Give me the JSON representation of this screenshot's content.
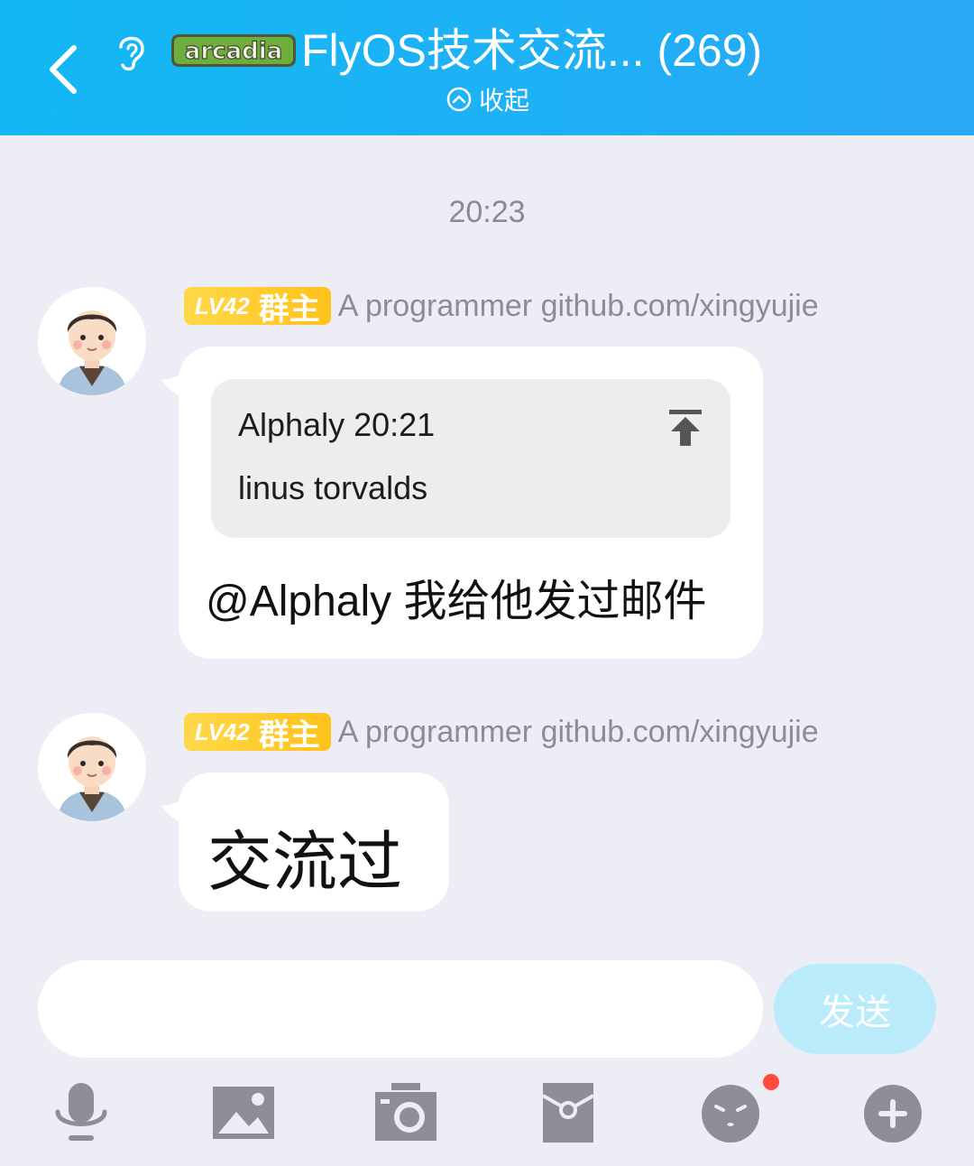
{
  "header": {
    "group_name": "FlyOS技术交流... (269)",
    "collapse_label": "收起",
    "badge_text": "arcadia"
  },
  "timestamp": "20:23",
  "messages": [
    {
      "level": "LV42",
      "role": "群主",
      "sender": "A programmer github.com/xingyujie",
      "quote": {
        "sender_time": "Alphaly 20:21",
        "text": "linus torvalds"
      },
      "text": "@Alphaly 我给他发过邮件"
    },
    {
      "level": "LV42",
      "role": "群主",
      "sender": "A programmer github.com/xingyujie",
      "text": "交流过"
    }
  ],
  "composer": {
    "input_value": "",
    "send_label": "发送"
  },
  "toolbar": {
    "icons": [
      "microphone-icon",
      "image-icon",
      "camera-icon",
      "red-packet-icon",
      "emoji-icon",
      "plus-icon"
    ],
    "emoji_has_notification": true
  },
  "colors": {
    "header_bg": "#12b8f3",
    "background": "#ededf6",
    "badge_gold": "#ffc21a",
    "send_disabled": "#b9ebfb",
    "icon_gray": "#8e8e98",
    "notification_red": "#ff4a3d"
  }
}
